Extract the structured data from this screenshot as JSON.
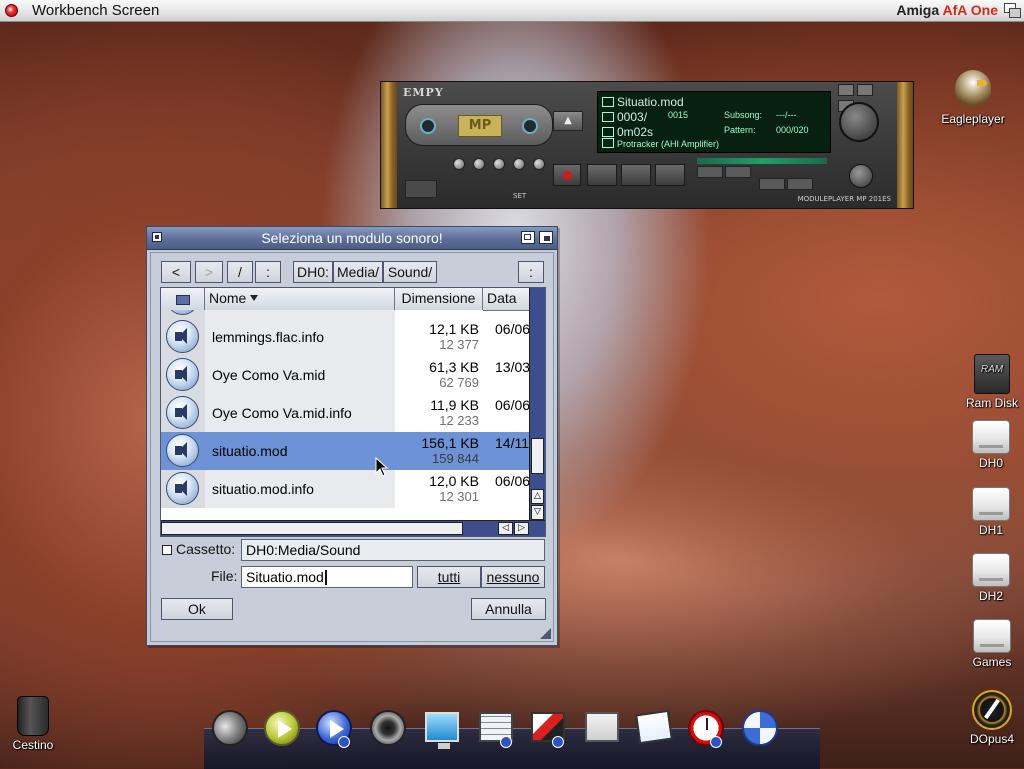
{
  "screen": {
    "title": "Workbench Screen",
    "brand_main": "Amiga ",
    "brand_accent": "AfA One"
  },
  "player": {
    "brand": "EMPY",
    "deck_logo": "MP",
    "song": "Situatio.mod",
    "position": "0003/",
    "position_total": "0015",
    "subsong_label": "Subsong:",
    "subsong_value": "---/---",
    "time": "0m02s",
    "pattern_label": "Pattern:",
    "pattern_value": "000/020",
    "format": "Protracker (AHI Amplifier)",
    "set_label": "SET",
    "model": "MODULEPLAYER MP 201ES"
  },
  "desktop_icons": {
    "eagleplayer": "Eagleplayer",
    "ram_disk": "Ram Disk",
    "ram_badge": "RAM",
    "dh0": "DH0",
    "dh1": "DH1",
    "dh2": "DH2",
    "games": "Games",
    "dopus": "DOpus4",
    "trash": "Cestino"
  },
  "requester": {
    "title": "Seleziona un modulo sonoro!",
    "nav": {
      "back": "<",
      "forward": ">",
      "parent": "/",
      "root": ":",
      "path_dh0": "DH0:",
      "path_media": "Media/",
      "path_sound": "Sound/",
      "menu": ":"
    },
    "columns": {
      "name": "Nome",
      "size": "Dimensione",
      "date": "Data"
    },
    "rows": [
      {
        "name": "lemmings.flac.info",
        "size": "12,1 KB",
        "bytes": "12 377",
        "date": "06/06",
        "selected": false
      },
      {
        "name": "Oye Como Va.mid",
        "size": "61,3 KB",
        "bytes": "62 769",
        "date": "13/03",
        "selected": false
      },
      {
        "name": "Oye Como Va.mid.info",
        "size": "11,9 KB",
        "bytes": "12 233",
        "date": "06/06",
        "selected": false
      },
      {
        "name": "situatio.mod",
        "size": "156,1 KB",
        "bytes": "159 844",
        "date": "14/11",
        "selected": true
      },
      {
        "name": "situatio.mod.info",
        "size": "12,0 KB",
        "bytes": "12 301",
        "date": "06/06",
        "selected": false
      }
    ],
    "drawer_label": "Cassetto:",
    "drawer_value": "DH0:Media/Sound",
    "file_label": "File:",
    "file_value": "Situatio.mod",
    "all_button": "tutti",
    "none_button": "nessuno",
    "ok_button": "Ok",
    "cancel_button": "Annulla"
  },
  "colors": {
    "titlebar": "#5d6f98",
    "selection": "#6d92d6",
    "accent_brand": "#d42a1c"
  },
  "icons": [
    "amiga-logo-icon",
    "screen-depth-icon",
    "close-icon",
    "zoom-icon",
    "depth-icon",
    "sound-file-icon",
    "sort-arrow-icon",
    "volume-icon",
    "scroll-up-icon",
    "scroll-down-icon",
    "scroll-left-icon",
    "scroll-right-icon"
  ]
}
